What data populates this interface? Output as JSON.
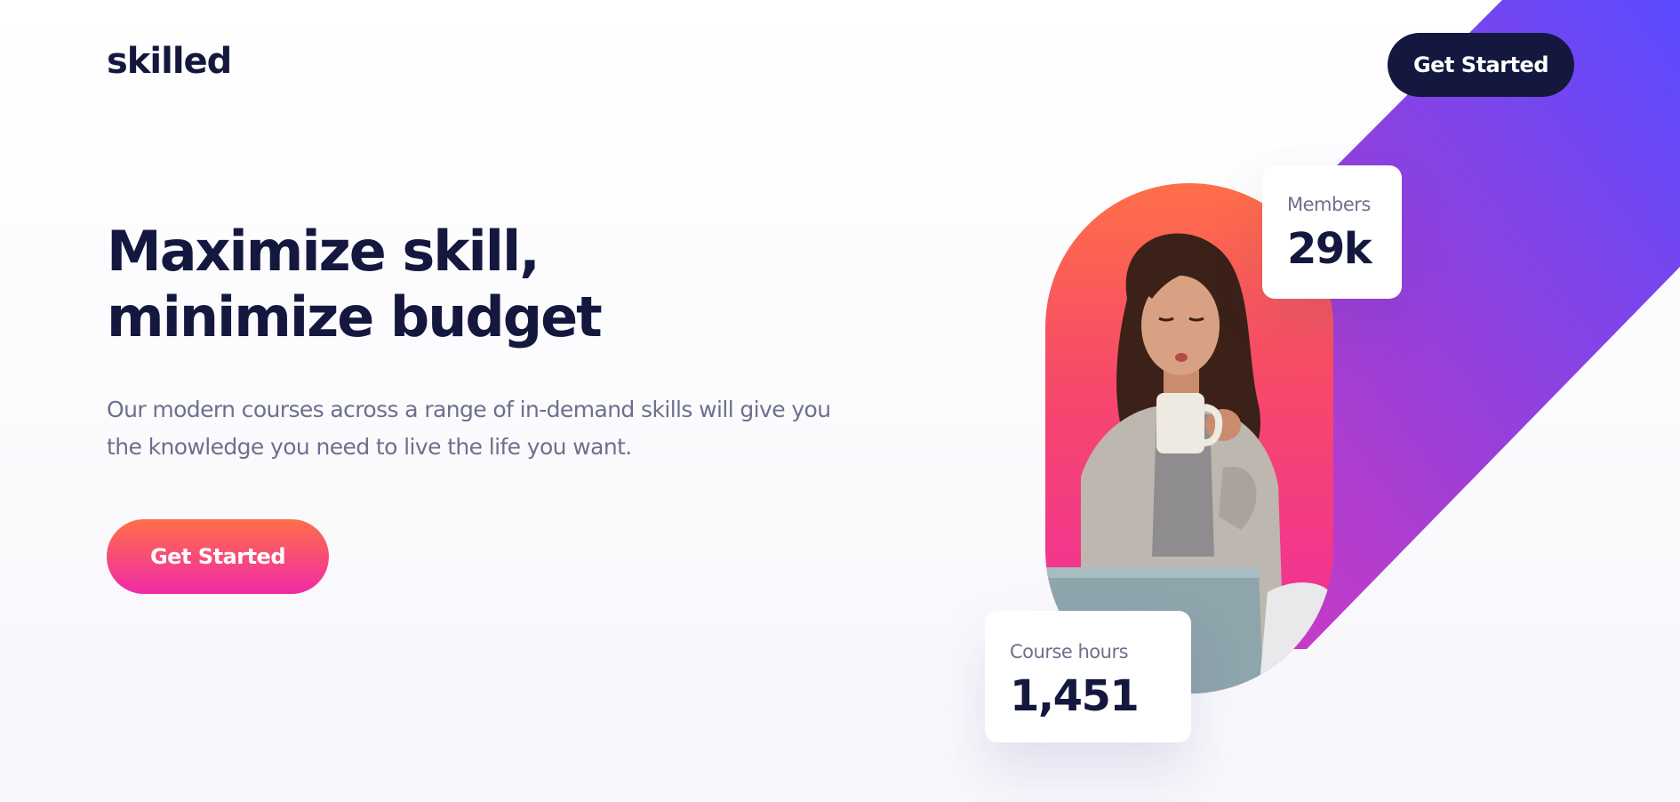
{
  "header": {
    "logo": "skilled",
    "cta_label": "Get Started"
  },
  "hero": {
    "title": "Maximize skill, minimize budget",
    "description": "Our modern courses across a range of in-demand skills will give you the knowledge you need to live the life you want.",
    "cta_label": "Get Started"
  },
  "stats": {
    "members": {
      "label": "Members",
      "value": "29k"
    },
    "course_hours": {
      "label": "Course hours",
      "value": "1,451"
    }
  },
  "theme": {
    "navy": "#14183e",
    "text_muted": "#6d708d",
    "gradient_orange": "#ff6f48",
    "gradient_pink": "#f02aa6",
    "gradient_purple": "#5b4bff",
    "gradient_magenta": "#c23fd0"
  },
  "icons": {
    "hero_image": "woman-drinking-coffee-with-laptop"
  }
}
